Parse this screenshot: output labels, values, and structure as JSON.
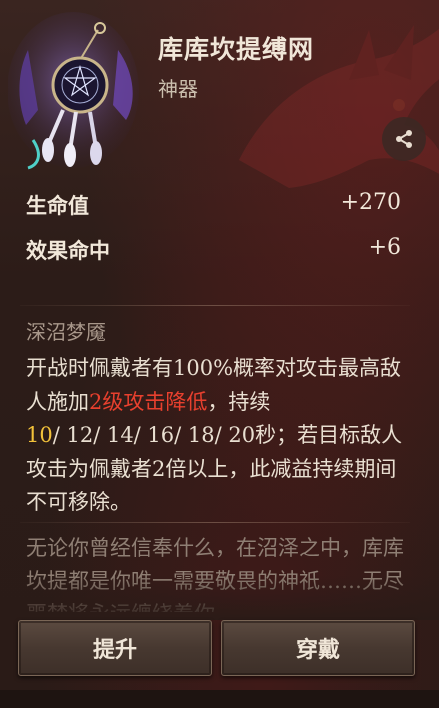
{
  "artifact": {
    "name": "库库坎提缚网",
    "type": "神器"
  },
  "stats": [
    {
      "label": "生命值",
      "value": "+270"
    },
    {
      "label": "效果命中",
      "value": "+6"
    }
  ],
  "skill": {
    "name": "深沼梦魇",
    "desc_part1": "开战时佩戴者有100%概率对攻击最高敌人施加",
    "desc_highlight": "2级攻击降低",
    "desc_part2": "，持续",
    "desc_level1": "10",
    "desc_levels_rest": "/ 12/ 14/ 16/ 18/ 20",
    "desc_part3": "秒；若目标敌人攻击为佩戴者2倍以上，此减益持续期间不可移除。"
  },
  "flavor": {
    "text": "无论你曾经信奉什么，在沼泽之中，库库坎提都是你唯一需要敬畏的神祇……无尽噩梦将永远缠绕着你。"
  },
  "buttons": {
    "upgrade": "提升",
    "equip": "穿戴"
  },
  "colors": {
    "highlight_red": "#e8402e",
    "highlight_gold": "#f2c23a"
  },
  "icons": {
    "share": "share-icon",
    "artifact": "dreamcatcher-icon"
  }
}
